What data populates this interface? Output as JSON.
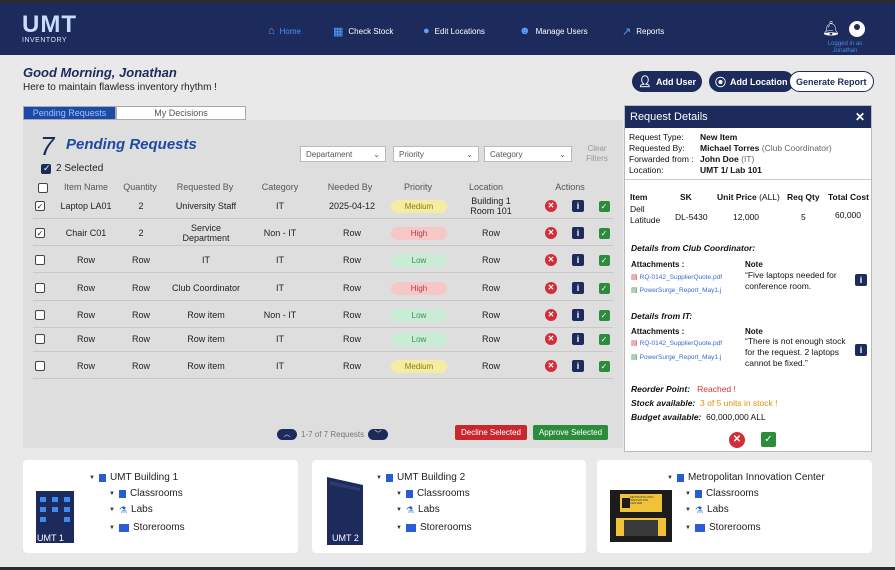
{
  "nav": {
    "logo_text": "UMT",
    "logo_sub": "INVENTORY",
    "items": [
      {
        "label": "Home",
        "icon": "home-icon"
      },
      {
        "label": "Check Stock",
        "icon": "boxes-icon"
      },
      {
        "label": "Edit Locations",
        "icon": "pin-icon"
      },
      {
        "label": "Manage Users",
        "icon": "users-icon"
      },
      {
        "label": "Reports",
        "icon": "chart-icon"
      }
    ],
    "logged_in": "Logged in as",
    "user": "Jonathan"
  },
  "header": {
    "greeting": "Good Morning, Jonathan",
    "subtitle": "Here to maintain flawless inventory rhythm !",
    "add_user": "Add User",
    "add_location": "Add Location",
    "generate_report": "Generate Report"
  },
  "tabs": {
    "pending": "Pending Requests",
    "decisions": "My Decisions"
  },
  "requests": {
    "count": "7",
    "title": "Pending Requests",
    "selected": "2 Selected",
    "filters": {
      "department": "Departament",
      "priority": "Priority",
      "category": "Category",
      "clear": "Clear Filters"
    },
    "columns": [
      "Item Name",
      "Quantity",
      "Requested By",
      "Category",
      "Needed By",
      "Priority",
      "Location",
      "Actions"
    ],
    "rows": [
      {
        "item": "Laptop LA01",
        "qty": "2",
        "by": "University Staff",
        "cat": "IT",
        "needed": "2025-04-12",
        "priority": "Medium",
        "location": "Building 1 Room 101"
      },
      {
        "item": "Chair C01",
        "qty": "2",
        "by": "Service Department",
        "cat": "Non - IT",
        "needed": "Row",
        "priority": "High",
        "location": "Row"
      },
      {
        "item": "Row",
        "qty": "Row",
        "by": "IT",
        "cat": "IT",
        "needed": "Row",
        "priority": "Low",
        "location": "Row"
      },
      {
        "item": "Row",
        "qty": "Row",
        "by": "Club Coordinator",
        "cat": "IT",
        "needed": "Row",
        "priority": "High",
        "location": "Row"
      },
      {
        "item": "Row",
        "qty": "Row",
        "by": "Row item",
        "cat": "Non - IT",
        "needed": "Row",
        "priority": "Low",
        "location": "Row"
      },
      {
        "item": "Row",
        "qty": "Row",
        "by": "Row item",
        "cat": "IT",
        "needed": "Row",
        "priority": "Low",
        "location": "Row"
      },
      {
        "item": "Row",
        "qty": "Row",
        "by": "Row item",
        "cat": "IT",
        "needed": "Row",
        "priority": "Medium",
        "location": "Row"
      }
    ],
    "pager": "1-7 of 7 Requests",
    "decline": "Decline Selected",
    "approve": "Approve Selected"
  },
  "buildings": [
    {
      "name": "UMT Building 1",
      "label": "UMT 1",
      "children": [
        "Classrooms",
        "Labs",
        "Storerooms"
      ]
    },
    {
      "name": "UMT Building 2",
      "label": "UMT 2",
      "children": [
        "Classrooms",
        "Labs",
        "Storerooms"
      ]
    },
    {
      "name": "Metropolitan Innovation Center",
      "label": "METROPOLITAN INNOVATION CENTER",
      "children": [
        "Classrooms",
        "Labs",
        "Storerooms"
      ]
    }
  ],
  "details": {
    "title": "Request Details",
    "type_label": "Request Type:",
    "type": "New Item",
    "by_label": "Requested By:",
    "by": "Michael Torres",
    "by_role": "(Club Coordinator)",
    "fwd_label": "Forwarded from :",
    "fwd": "John Doe",
    "fwd_role": "(IT)",
    "loc_label": "Location:",
    "loc": "UMT 1/ Lab 101",
    "h_item": "Item",
    "h_sk": "SK",
    "h_price": "Unit Price",
    "h_price_unit": "(ALL)",
    "h_req": "Req Qty",
    "h_total": "Total Cost",
    "item": "Dell Latitude",
    "sk": "DL-5430",
    "price": "12,000",
    "req": "5",
    "total": "60,000",
    "club_title": "Details from Club Coordinator:",
    "attachments": "Attachments :",
    "note": "Note",
    "file1": "RQ-0142_SupplierQuote.pdf",
    "file2": "PowerSurge_Report_May1.j",
    "club_note": "“Five laptops needed for conference  room.",
    "it_title": "Details from IT:",
    "it_note": "“There is not enough stock for the request. 2 laptops cannot be fixed.”",
    "reorder_label": "Reorder Point:",
    "reorder": "Reached !",
    "stock_label": "Stock available:",
    "stock": "3 of 5 units in stock !",
    "budget_label": "Budget available:",
    "budget": "60,000,000 ALL"
  }
}
